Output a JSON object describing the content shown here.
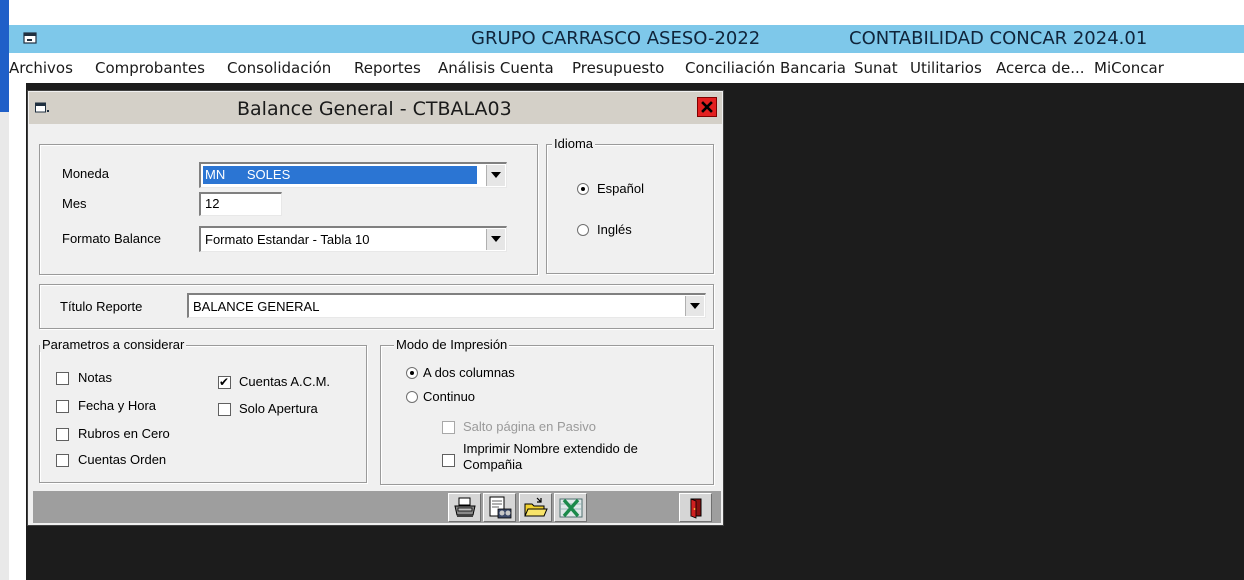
{
  "app": {
    "title_left": "GRUPO CARRASCO ASESO-2022",
    "title_right": "CONTABILIDAD CONCAR 2024.01"
  },
  "menu": [
    "Archivos",
    "Comprobantes",
    "Consolidación",
    "Reportes",
    "Análisis Cuenta",
    "Presupuesto",
    "Conciliación Bancaria",
    "Sunat",
    "Utilitarios",
    "Acerca de...",
    "MiConcar"
  ],
  "dialog": {
    "title": "Balance General  - CTBALA03",
    "moneda": {
      "label": "Moneda",
      "value": "MN      SOLES"
    },
    "mes": {
      "label": "Mes",
      "value": "12"
    },
    "formato": {
      "label": "Formato Balance",
      "value": "Formato Estandar - Tabla 10"
    },
    "idioma": {
      "legend": "Idioma",
      "options": [
        {
          "label": "Español",
          "selected": true
        },
        {
          "label": "Inglés",
          "selected": false
        }
      ]
    },
    "titulo": {
      "label": "Título Reporte",
      "value": "BALANCE GENERAL"
    },
    "parametros": {
      "legend": "Parametros  a  considerar",
      "items": [
        {
          "label": "Notas",
          "checked": false
        },
        {
          "label": "Fecha y Hora",
          "checked": false
        },
        {
          "label": "Rubros en Cero",
          "checked": false
        },
        {
          "label": "Cuentas Orden",
          "checked": false
        },
        {
          "label": "Cuentas A.C.M.",
          "checked": true
        },
        {
          "label": "Solo Apertura",
          "checked": false
        }
      ]
    },
    "modo": {
      "legend": "Modo de Impresión",
      "options": [
        {
          "label": "A dos columnas",
          "selected": true
        },
        {
          "label": "Continuo",
          "selected": false
        }
      ],
      "salto": {
        "label": "Salto página en Pasivo",
        "checked": false,
        "disabled": true
      },
      "nombre": {
        "label_line1": "Imprimir Nombre extendido de",
        "label_line2": "Compañia",
        "checked": false
      }
    },
    "toolbar": [
      "print-icon",
      "preview-icon",
      "open-folder-icon",
      "excel-icon",
      "exit-door-icon"
    ]
  }
}
